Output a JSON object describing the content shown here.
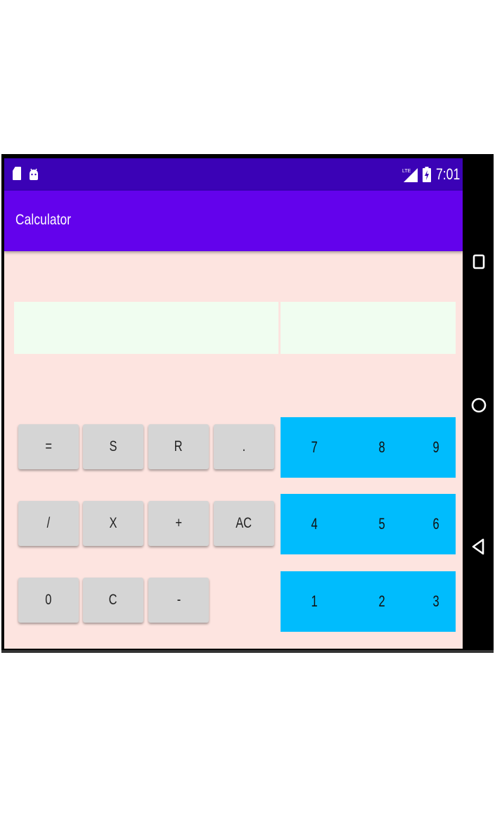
{
  "status_bar": {
    "time": "7:01",
    "icons": [
      "sd-card-icon",
      "android-icon",
      "lte-signal-icon",
      "battery-charging-icon"
    ]
  },
  "app_bar": {
    "title": "Calculator"
  },
  "displays": {
    "left_value": "",
    "right_value": ""
  },
  "operator_buttons": {
    "row1": [
      "=",
      "S",
      "R",
      "."
    ],
    "row2": [
      "/",
      "X",
      "+",
      "AC"
    ],
    "row3": [
      "0",
      "C",
      "-"
    ]
  },
  "number_pad": {
    "row1": [
      "7",
      "8",
      "9"
    ],
    "row2": [
      "4",
      "5",
      "6"
    ],
    "row3": [
      "1",
      "2",
      "3"
    ]
  },
  "nav_bar": {
    "icons": [
      "recents-icon",
      "home-icon",
      "back-icon"
    ]
  },
  "colors": {
    "status_bar": "#3b02b6",
    "app_bar": "#6302ec",
    "background": "#fde4e0",
    "display": "#f0fdf0",
    "operator_button": "#d5d5d5",
    "number_pad": "#00bcfd"
  }
}
